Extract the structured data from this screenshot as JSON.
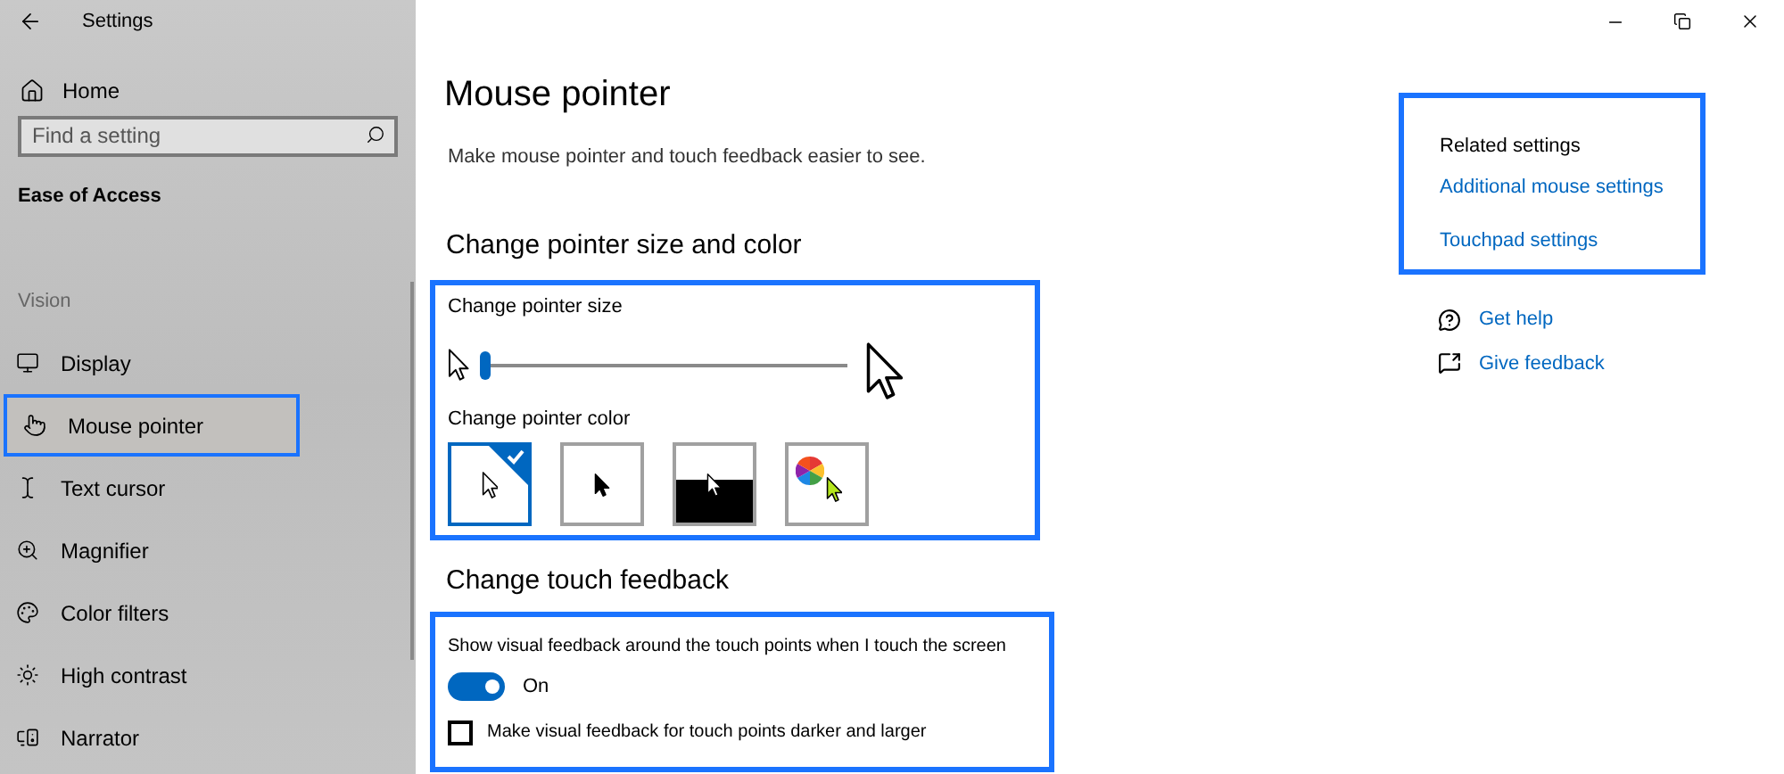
{
  "window": {
    "title": "Settings"
  },
  "sidebar": {
    "home": "Home",
    "search": {
      "placeholder": "Find a setting"
    },
    "category": "Ease of Access",
    "group": "Vision",
    "items": [
      {
        "label": "Display",
        "selected": false
      },
      {
        "label": "Mouse pointer",
        "selected": true
      },
      {
        "label": "Text cursor",
        "selected": false
      },
      {
        "label": "Magnifier",
        "selected": false
      },
      {
        "label": "Color filters",
        "selected": false
      },
      {
        "label": "High contrast",
        "selected": false
      },
      {
        "label": "Narrator",
        "selected": false
      }
    ]
  },
  "page": {
    "title": "Mouse pointer",
    "subtitle": "Make mouse pointer and touch feedback easier to see.",
    "pointer_section": {
      "heading": "Change pointer size and color",
      "size_label": "Change pointer size",
      "size_slider": {
        "level": 0
      },
      "color_label": "Change pointer color",
      "colors": [
        {
          "kind": "white",
          "selected": true
        },
        {
          "kind": "black",
          "selected": false
        },
        {
          "kind": "inverted",
          "selected": false
        },
        {
          "kind": "custom",
          "selected": false
        }
      ]
    },
    "touch_section": {
      "heading": "Change touch feedback",
      "toggle_label": "Show visual feedback around the touch points when I touch the screen",
      "toggle": {
        "on": true,
        "state_text": "On"
      },
      "checkbox": {
        "label": "Make visual feedback for touch points darker and larger",
        "checked": false
      }
    }
  },
  "related": {
    "heading": "Related settings",
    "links": [
      "Additional mouse settings",
      "Touchpad settings"
    ]
  },
  "help_links": [
    {
      "kind": "help",
      "label": "Get help"
    },
    {
      "kind": "feedback",
      "label": "Give feedback"
    }
  ]
}
